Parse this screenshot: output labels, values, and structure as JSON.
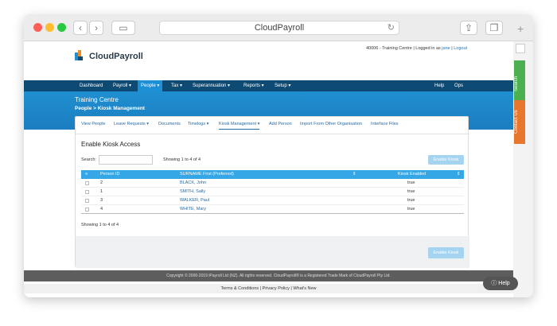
{
  "browser": {
    "url": "CloudPayroll"
  },
  "header": {
    "brand": "CloudPayroll",
    "account_prefix": "40006 - Training Centre | Logged in as ",
    "user": "jane",
    "sep": " | ",
    "logout": "Logout"
  },
  "nav": {
    "items": [
      "Dashboard",
      "Payroll ▾",
      "People ▾",
      "Tax ▾",
      "Superannuation ▾",
      "Reports ▾",
      "Setup ▾"
    ],
    "right": [
      "Help",
      "Ops"
    ]
  },
  "hero": {
    "org": "Training Centre",
    "breadcrumb": "People > Kiosk Management"
  },
  "subnav": [
    "View People",
    "Leave Requests ▾",
    "Documents",
    "Timelogs ▾",
    "Kiosk Management ▾",
    "Add Person",
    "Import From Other Organisation",
    "Interface Files"
  ],
  "panel": {
    "title": "Enable Kiosk Access",
    "enable_btn": "Enable Kiosk",
    "search_label": "Search:",
    "showing_top": "Showing 1 to 4 of 4",
    "showing_bottom": "Showing 1 to 4 of 4"
  },
  "table": {
    "columns": [
      "Person ID",
      "SURNAME First (Preferred)",
      "Kiosk Enabled"
    ],
    "rows": [
      {
        "id": "2",
        "name": "BLACK, John",
        "enabled": "true"
      },
      {
        "id": "1",
        "name": "SMITH, Sally",
        "enabled": "true"
      },
      {
        "id": "3",
        "name": "WALKER, Paul",
        "enabled": "true"
      },
      {
        "id": "4",
        "name": "WHITE, Mary",
        "enabled": "true"
      }
    ]
  },
  "footer": {
    "links": "Terms & Conditions | Privacy Policy | What's New",
    "copyright": "Copyright © 2000-2019 iPayroll Ltd (NZ). All rights reserved. CloudPayroll® is a Registered Trade Mark of CloudPayroll Pty Ltd."
  },
  "side": {
    "search": "Search",
    "contact": "Contact Us"
  },
  "help": "Help"
}
